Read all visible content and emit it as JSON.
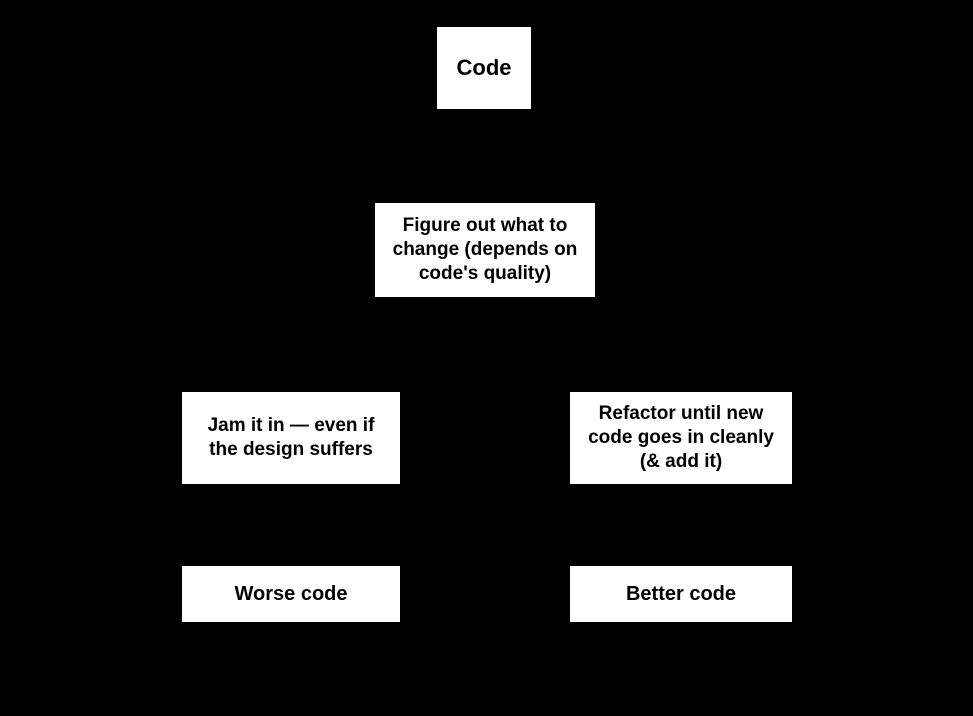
{
  "diagram": {
    "node_code": "Code",
    "node_figure": "Figure out what to change (depends on code's quality)",
    "node_jam": "Jam it in — even if the design suffers",
    "node_refactor": "Refactor until new code goes in cleanly (& add it)",
    "node_worse": "Worse code",
    "node_better": "Better code"
  },
  "chart_data": {
    "type": "diagram",
    "nodes": [
      {
        "id": "code",
        "label": "Code"
      },
      {
        "id": "figure",
        "label": "Figure out what to change (depends on code's quality)"
      },
      {
        "id": "jam",
        "label": "Jam it in — even if the design suffers"
      },
      {
        "id": "refactor",
        "label": "Refactor until new code goes in cleanly (& add it)"
      },
      {
        "id": "worse",
        "label": "Worse code"
      },
      {
        "id": "better",
        "label": "Better code"
      }
    ],
    "edges": [
      {
        "from": "code",
        "to": "figure"
      },
      {
        "from": "figure",
        "to": "jam"
      },
      {
        "from": "figure",
        "to": "refactor"
      },
      {
        "from": "jam",
        "to": "worse"
      },
      {
        "from": "refactor",
        "to": "better"
      }
    ]
  }
}
